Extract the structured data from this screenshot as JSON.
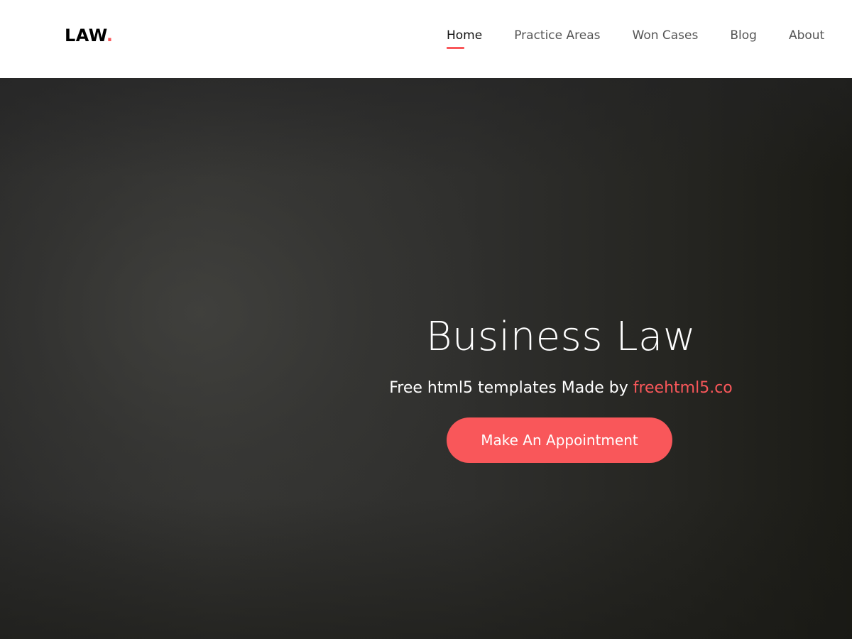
{
  "brand": {
    "logo_text": "LAW",
    "logo_dot": ".",
    "accent_color": "#f9575a"
  },
  "nav": {
    "items": [
      {
        "label": "Home",
        "active": true
      },
      {
        "label": "Practice Areas",
        "active": false
      },
      {
        "label": "Won Cases",
        "active": false
      },
      {
        "label": "Blog",
        "active": false
      },
      {
        "label": "About",
        "active": false
      }
    ]
  },
  "hero": {
    "title": "Business Law",
    "subtitle_prefix": "Free html5 templates Made by ",
    "subtitle_link": "freehtml5.co",
    "cta_label": "Make An Appointment"
  }
}
